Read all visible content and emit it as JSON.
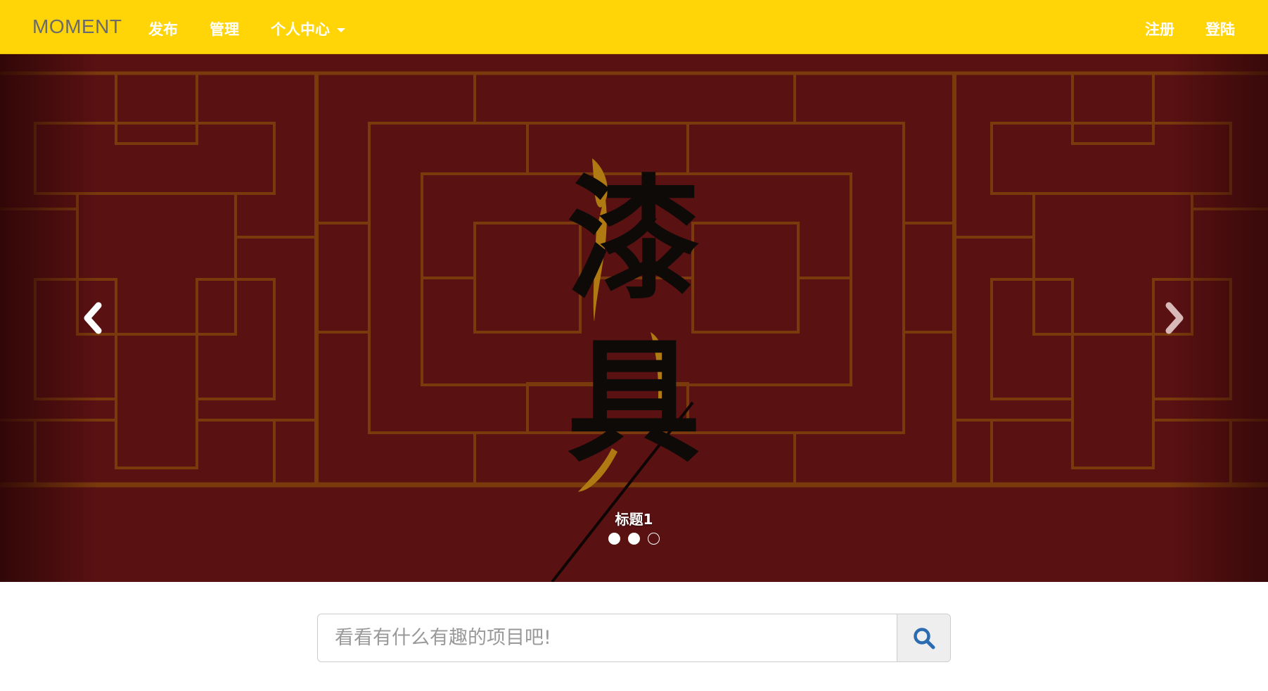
{
  "navbar": {
    "brand": "MOMENT",
    "left_items": [
      "发布",
      "管理"
    ],
    "dropdown_label": "个人中心",
    "right_items": [
      "注册",
      "登陆"
    ],
    "background_color": "#ffd507"
  },
  "carousel": {
    "artwork_text": [
      "漆",
      "具"
    ],
    "caption": "标题1",
    "indicators": [
      true,
      true,
      false
    ],
    "prev_icon": "chevron-left-icon",
    "next_icon": "chevron-right-icon",
    "background_color": "#5a1112",
    "lattice_color": "#7a3a0c",
    "accent_color": "#b07a12"
  },
  "search": {
    "placeholder": "看看有什么有趣的项目吧!",
    "value": "",
    "button_icon": "search-icon",
    "icon_color": "#2b6cb0"
  }
}
